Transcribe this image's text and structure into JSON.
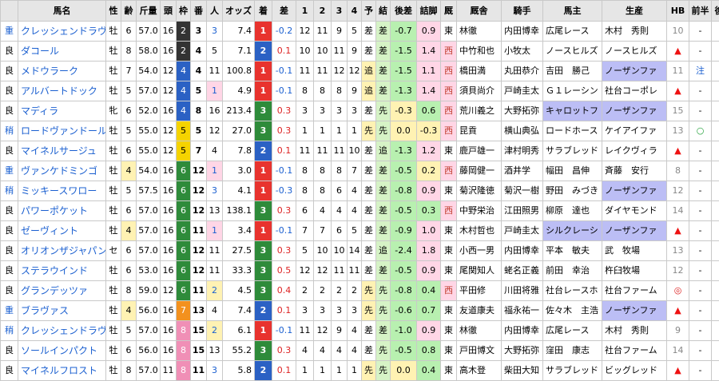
{
  "headers": [
    "馬名",
    "性",
    "齢",
    "斤量",
    "頭",
    "枠",
    "番",
    "人",
    "オッズ",
    "着",
    "差",
    "1",
    "2",
    "3",
    "4",
    "予",
    "結",
    "後差",
    "詰脚",
    "厩",
    "厩舎",
    "騎手",
    "馬主",
    "生産",
    "HB",
    "前半",
    "後半"
  ],
  "rows": [
    {
      "baba": "重",
      "name": "クレッシェンドラヴ",
      "sex": "牡",
      "age": "6",
      "kin": "57.0",
      "tou": "16",
      "waku": "2",
      "ban": "3",
      "nin": "3",
      "odds": "7.4",
      "chaku": "1",
      "sa": "-0.2",
      "c1": "12",
      "c2": "11",
      "c3": "9",
      "c4": "5",
      "yo": "差",
      "ketsu": "差",
      "atosa": "-0.7",
      "tsume": "0.9",
      "umaya": "東",
      "kyu": "林徹",
      "kishu": "内田博幸",
      "banushi": "広尾レース",
      "sei": "木村　秀則",
      "hb": "10",
      "zen": "-",
      "kou": "○"
    },
    {
      "baba": "良",
      "name": "ダコール",
      "sex": "牡",
      "age": "8",
      "kin": "58.0",
      "tou": "16",
      "waku": "2",
      "ban": "4",
      "nin": "5",
      "odds": "7.1",
      "chaku": "2",
      "sa": "0.1",
      "c1": "10",
      "c2": "10",
      "c3": "11",
      "c4": "9",
      "yo": "差",
      "ketsu": "差",
      "atosa": "-1.5",
      "tsume": "1.4",
      "umaya": "西",
      "kyu": "中竹和也",
      "kishu": "小牧太",
      "banushi": "ノースヒルズ",
      "sei": "ノースヒルズ",
      "hb": "▲",
      "zen": "-",
      "kou": "◎"
    },
    {
      "baba": "良",
      "name": "メドウラーク",
      "sex": "牡",
      "age": "7",
      "kin": "54.0",
      "tou": "12",
      "waku": "4",
      "ban": "4",
      "nin": "11",
      "odds": "100.8",
      "chaku": "1",
      "sa": "-0.1",
      "c1": "11",
      "c2": "11",
      "c3": "12",
      "c4": "12",
      "yo": "追",
      "ketsu": "差",
      "atosa": "-1.5",
      "tsume": "1.1",
      "umaya": "西",
      "kyu": "橋田満",
      "kishu": "丸田恭介",
      "banushi": "吉田　勝己",
      "sei": "ノーザンファ",
      "hb": "11",
      "zen": "注",
      "kou": "-"
    },
    {
      "baba": "良",
      "name": "アルバートドック",
      "sex": "牡",
      "age": "5",
      "kin": "57.0",
      "tou": "12",
      "waku": "4",
      "ban": "5",
      "nin": "1",
      "odds": "4.9",
      "chaku": "1",
      "sa": "-0.1",
      "c1": "8",
      "c2": "8",
      "c3": "8",
      "c4": "9",
      "yo": "追",
      "ketsu": "差",
      "atosa": "-1.3",
      "tsume": "1.4",
      "umaya": "西",
      "kyu": "須貝尚介",
      "kishu": "戸崎圭太",
      "banushi": "Ｇ１レーシン",
      "sei": "社台コーポレ",
      "hb": "▲",
      "zen": "-",
      "kou": "▲"
    },
    {
      "baba": "良",
      "name": "マディラ",
      "sex": "牝",
      "age": "6",
      "kin": "52.0",
      "tou": "16",
      "waku": "4",
      "ban": "8",
      "nin": "16",
      "odds": "213.4",
      "chaku": "3",
      "sa": "0.3",
      "c1": "3",
      "c2": "3",
      "c3": "3",
      "c4": "3",
      "yo": "差",
      "ketsu": "先",
      "atosa": "-0.3",
      "tsume": "0.6",
      "umaya": "西",
      "kyu": "荒川義之",
      "kishu": "大野拓弥",
      "banushi": "キャロットフ",
      "sei": "ノーザンファ",
      "hb": "15",
      "zen": "-",
      "kou": "-"
    },
    {
      "baba": "稍",
      "name": "ロードヴァンドール",
      "sex": "牡",
      "age": "5",
      "kin": "55.0",
      "tou": "12",
      "waku": "5",
      "ban": "5",
      "nin": "12",
      "odds": "27.0",
      "chaku": "3",
      "sa": "0.3",
      "c1": "1",
      "c2": "1",
      "c3": "1",
      "c4": "1",
      "yo": "先",
      "ketsu": "先",
      "atosa": "0.0",
      "tsume": "-0.3",
      "umaya": "西",
      "kyu": "昆貢",
      "kishu": "横山典弘",
      "banushi": "ロードホース",
      "sei": "ケイアイファ",
      "hb": "13",
      "zen": "○",
      "kou": "-"
    },
    {
      "baba": "良",
      "name": "マイネルサージュ",
      "sex": "牡",
      "age": "6",
      "kin": "55.0",
      "tou": "12",
      "waku": "5",
      "ban": "7",
      "nin": "4",
      "odds": "7.8",
      "chaku": "2",
      "sa": "0.1",
      "c1": "11",
      "c2": "11",
      "c3": "11",
      "c4": "10",
      "yo": "差",
      "ketsu": "追",
      "atosa": "-1.3",
      "tsume": "1.2",
      "umaya": "東",
      "kyu": "鹿戸雄一",
      "kishu": "津村明秀",
      "banushi": "サラブレッド",
      "sei": "レイクヴィラ",
      "hb": "▲",
      "zen": "-",
      "kou": "-"
    },
    {
      "baba": "重",
      "name": "ヴァンケドミンゴ",
      "sex": "牡",
      "age": "4",
      "kin": "54.0",
      "tou": "16",
      "waku": "6",
      "ban": "12",
      "nin": "1",
      "odds": "3.0",
      "chaku": "1",
      "sa": "-0.1",
      "c1": "8",
      "c2": "8",
      "c3": "8",
      "c4": "7",
      "yo": "差",
      "ketsu": "差",
      "atosa": "-0.5",
      "tsume": "0.2",
      "umaya": "西",
      "kyu": "藤岡健一",
      "kishu": "酒井学",
      "banushi": "幅田　昌伸",
      "sei": "斉藤　安行",
      "hb": "8",
      "zen": "-",
      "kou": "◎"
    },
    {
      "baba": "稍",
      "name": "ミッキースワロー",
      "sex": "牡",
      "age": "5",
      "kin": "57.5",
      "tou": "16",
      "waku": "6",
      "ban": "12",
      "nin": "3",
      "odds": "4.1",
      "chaku": "1",
      "sa": "-0.3",
      "c1": "8",
      "c2": "8",
      "c3": "6",
      "c4": "4",
      "yo": "差",
      "ketsu": "差",
      "atosa": "-0.8",
      "tsume": "0.9",
      "umaya": "東",
      "kyu": "菊沢隆徳",
      "kishu": "菊沢一樹",
      "banushi": "野田　みづき",
      "sei": "ノーザンファ",
      "hb": "12",
      "zen": "-",
      "kou": "○"
    },
    {
      "baba": "良",
      "name": "パワーポケット",
      "sex": "牡",
      "age": "6",
      "kin": "57.0",
      "tou": "16",
      "waku": "6",
      "ban": "12",
      "nin": "13",
      "odds": "138.1",
      "chaku": "3",
      "sa": "0.3",
      "c1": "6",
      "c2": "4",
      "c3": "4",
      "c4": "4",
      "yo": "差",
      "ketsu": "差",
      "atosa": "-0.5",
      "tsume": "0.3",
      "umaya": "西",
      "kyu": "中野栄治",
      "kishu": "江田照男",
      "banushi": "柳原　達也",
      "sei": "ダイヤモンド",
      "hb": "14",
      "zen": "-",
      "kou": "-"
    },
    {
      "baba": "良",
      "name": "ゼーヴィント",
      "sex": "牡",
      "age": "4",
      "kin": "57.0",
      "tou": "16",
      "waku": "6",
      "ban": "11",
      "nin": "1",
      "odds": "3.4",
      "chaku": "1",
      "sa": "-0.1",
      "c1": "7",
      "c2": "7",
      "c3": "6",
      "c4": "5",
      "yo": "差",
      "ketsu": "差",
      "atosa": "-0.9",
      "tsume": "1.0",
      "umaya": "東",
      "kyu": "木村哲也",
      "kishu": "戸崎圭太",
      "banushi": "シルクレーシ",
      "sei": "ノーザンファ",
      "hb": "▲",
      "zen": "-",
      "kou": "-"
    },
    {
      "baba": "良",
      "name": "オリオンザジャパン",
      "sex": "セ",
      "age": "6",
      "kin": "57.0",
      "tou": "16",
      "waku": "6",
      "ban": "12",
      "nin": "11",
      "odds": "27.5",
      "chaku": "3",
      "sa": "0.3",
      "c1": "5",
      "c2": "10",
      "c3": "10",
      "c4": "14",
      "yo": "差",
      "ketsu": "追",
      "atosa": "-2.4",
      "tsume": "1.8",
      "umaya": "東",
      "kyu": "小西一男",
      "kishu": "内田博幸",
      "banushi": "平本　敏夫",
      "sei": "武　牧場",
      "hb": "13",
      "zen": "-",
      "kou": "○"
    },
    {
      "baba": "良",
      "name": "ステラウインド",
      "sex": "牡",
      "age": "6",
      "kin": "53.0",
      "tou": "16",
      "waku": "6",
      "ban": "12",
      "nin": "11",
      "odds": "33.3",
      "chaku": "3",
      "sa": "0.5",
      "c1": "12",
      "c2": "12",
      "c3": "11",
      "c4": "11",
      "yo": "差",
      "ketsu": "差",
      "atosa": "-0.5",
      "tsume": "0.9",
      "umaya": "東",
      "kyu": "尾関知人",
      "kishu": "蛯名正義",
      "banushi": "前田　幸治",
      "sei": "杵臼牧場",
      "hb": "12",
      "zen": "-",
      "kou": "▽"
    },
    {
      "baba": "良",
      "name": "グランデッツァ",
      "sex": "牡",
      "age": "8",
      "kin": "59.0",
      "tou": "12",
      "waku": "6",
      "ban": "11",
      "nin": "2",
      "odds": "4.5",
      "chaku": "3",
      "sa": "0.4",
      "c1": "2",
      "c2": "2",
      "c3": "2",
      "c4": "2",
      "yo": "先",
      "ketsu": "先",
      "atosa": "-0.8",
      "tsume": "0.4",
      "umaya": "西",
      "kyu": "平田修",
      "kishu": "川田将雅",
      "banushi": "社台レースホ",
      "sei": "社台ファーム",
      "hb": "◎",
      "zen": "-",
      "kou": "注"
    },
    {
      "baba": "重",
      "name": "ブラヴァス",
      "sex": "牡",
      "age": "4",
      "kin": "56.0",
      "tou": "16",
      "waku": "7",
      "ban": "13",
      "nin": "4",
      "odds": "7.4",
      "chaku": "2",
      "sa": "0.1",
      "c1": "3",
      "c2": "3",
      "c3": "3",
      "c4": "3",
      "yo": "先",
      "ketsu": "先",
      "atosa": "-0.6",
      "tsume": "0.7",
      "umaya": "東",
      "kyu": "友道康夫",
      "kishu": "福永祐一",
      "banushi": "佐々木　主浩",
      "sei": "ノーザンファ",
      "hb": "▲",
      "zen": "-",
      "kou": "▲"
    },
    {
      "baba": "稍",
      "name": "クレッシェンドラヴ",
      "sex": "牡",
      "age": "5",
      "kin": "57.0",
      "tou": "16",
      "waku": "8",
      "ban": "15",
      "nin": "2",
      "odds": "6.1",
      "chaku": "1",
      "sa": "-0.1",
      "c1": "11",
      "c2": "12",
      "c3": "9",
      "c4": "4",
      "yo": "差",
      "ketsu": "差",
      "atosa": "-1.0",
      "tsume": "0.9",
      "umaya": "東",
      "kyu": "林徹",
      "kishu": "内田博幸",
      "banushi": "広尾レース",
      "sei": "木村　秀則",
      "hb": "9",
      "zen": "-",
      "kou": "▲"
    },
    {
      "baba": "良",
      "name": "ソールインパクト",
      "sex": "牡",
      "age": "6",
      "kin": "56.0",
      "tou": "16",
      "waku": "8",
      "ban": "15",
      "nin": "13",
      "odds": "55.2",
      "chaku": "3",
      "sa": "0.3",
      "c1": "4",
      "c2": "4",
      "c3": "4",
      "c4": "4",
      "yo": "差",
      "ketsu": "先",
      "atosa": "-0.5",
      "tsume": "0.8",
      "umaya": "東",
      "kyu": "戸田博文",
      "kishu": "大野拓弥",
      "banushi": "窪田　康志",
      "sei": "社台ファーム",
      "hb": "14",
      "zen": "-",
      "kou": "-"
    },
    {
      "baba": "良",
      "name": "マイネルフロスト",
      "sex": "牡",
      "age": "8",
      "kin": "57.0",
      "tou": "11",
      "waku": "8",
      "ban": "11",
      "nin": "3",
      "odds": "5.8",
      "chaku": "2",
      "sa": "0.1",
      "c1": "1",
      "c2": "1",
      "c3": "1",
      "c4": "1",
      "yo": "先",
      "ketsu": "先",
      "atosa": "0.0",
      "tsume": "0.4",
      "umaya": "東",
      "kyu": "高木登",
      "kishu": "柴田大知",
      "banushi": "サラブレッド",
      "sei": "ビッグレッド",
      "hb": "▲",
      "zen": "-",
      "kou": "-"
    }
  ],
  "colors": {
    "waku1": "#ffffff",
    "waku2": "#333333",
    "waku3": "#e8332e",
    "waku4": "#2b61c4",
    "waku5": "#f5d300",
    "waku6": "#2e8b3a",
    "waku7": "#f3911e",
    "waku8": "#f08fb6"
  }
}
